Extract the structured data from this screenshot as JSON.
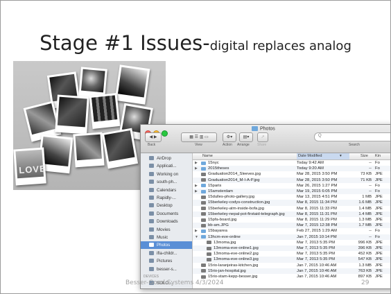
{
  "slide": {
    "title_main": "Stage #1 Issues-",
    "title_sub": "digital replaces analog",
    "footer": "Besser-Good Systems 4/3/2024",
    "page_number": "29"
  },
  "collage": {
    "text": "LOVE"
  },
  "finder": {
    "window_title": "Photos",
    "colors": {
      "selection": "#5a8fd6",
      "folder": "#6fa8dc",
      "sidebar_bg": "#e8ebef"
    },
    "toolbar": {
      "back_label": "Back",
      "view_label": "View",
      "action_label": "Action",
      "arrange_label": "Arrange",
      "share_label": "Share",
      "search_label": "Search",
      "search_glyph": "Q"
    },
    "sidebar": {
      "items": [
        {
          "label": "AirDrop",
          "icon": "airdrop-icon"
        },
        {
          "label": "Applicati...",
          "icon": "applications-icon"
        },
        {
          "label": "Working on",
          "icon": "folder-icon"
        },
        {
          "label": "south-ph...",
          "icon": "folder-icon"
        },
        {
          "label": "Calendars",
          "icon": "folder-icon"
        },
        {
          "label": "Rapidly-...",
          "icon": "folder-icon"
        },
        {
          "label": "Desktop",
          "icon": "desktop-icon"
        },
        {
          "label": "Documents",
          "icon": "documents-icon"
        },
        {
          "label": "Downloads",
          "icon": "downloads-icon"
        },
        {
          "label": "Movies",
          "icon": "movies-icon"
        },
        {
          "label": "Music",
          "icon": "music-icon"
        },
        {
          "label": "Photos",
          "icon": "photos-icon",
          "selected": true
        },
        {
          "label": "ifla-childr...",
          "icon": "folder-icon"
        },
        {
          "label": "Pictures",
          "icon": "pictures-icon"
        },
        {
          "label": "besser-s...",
          "icon": "folder-icon"
        }
      ],
      "devices_heading": "DEVICES",
      "device_item": "SOLO..."
    },
    "columns": {
      "name": "Name",
      "date": "Date Modified",
      "size": "Size",
      "kind": "Kin"
    },
    "rows": [
      {
        "name": "15nyc",
        "date": "Today 9:42 AM",
        "size": "--",
        "kind": "Fo",
        "type": "folder",
        "disc": "▶",
        "indent": 0
      },
      {
        "name": "2015theses",
        "date": "Today 9:20 AM",
        "size": "--",
        "kind": "Fo",
        "type": "folder",
        "disc": "▶",
        "indent": 0
      },
      {
        "name": "Graduation2014_Sleeves.jpg",
        "date": "Mar 28, 2015 3:50 PM",
        "size": "73 KB",
        "kind": "JPE",
        "type": "file",
        "disc": "",
        "indent": 0
      },
      {
        "name": "Graduation2014_M-I-A-P.jpg",
        "date": "Mar 28, 2015 3:50 PM",
        "size": "71 KB",
        "kind": "JPE",
        "type": "file",
        "disc": "",
        "indent": 0
      },
      {
        "name": "15paris",
        "date": "Mar 26, 2015 1:27 PM",
        "size": "--",
        "kind": "Fo",
        "type": "folder",
        "disc": "▶",
        "indent": 0
      },
      {
        "name": "15amsterdam",
        "date": "Mar 19, 2015 6:05 PM",
        "size": "--",
        "kind": "Fo",
        "type": "folder",
        "disc": "▶",
        "indent": 0
      },
      {
        "name": "15dulles-photo-gallery.jpg",
        "date": "Mar 13, 2015 4:51 PM",
        "size": "1 MB",
        "kind": "JPE",
        "type": "file",
        "disc": "",
        "indent": 0
      },
      {
        "name": "15berkeley-codys-construction.jpg",
        "date": "Mar 8, 2015 11:34 PM",
        "size": "1.6 MB",
        "kind": "JPE",
        "type": "file",
        "disc": "",
        "indent": 0
      },
      {
        "name": "15berkeley-atm-inside-bofa.jpg",
        "date": "Mar 8, 2015 11:33 PM",
        "size": "1.4 MB",
        "kind": "JPE",
        "type": "file",
        "disc": "",
        "indent": 0
      },
      {
        "name": "15berkeley-nepal-pot-firstaid-telegraph.jpg",
        "date": "Mar 8, 2015 11:31 PM",
        "size": "1.4 MB",
        "kind": "JPE",
        "type": "file",
        "disc": "",
        "indent": 0
      },
      {
        "name": "15pfa-board.jpg",
        "date": "Mar 8, 2015 11:29 PM",
        "size": "1.3 MB",
        "kind": "JPE",
        "type": "file",
        "disc": "",
        "indent": 0
      },
      {
        "name": "bb-am.JPG",
        "date": "Mar 7, 2015 12:38 PM",
        "size": "1.7 MB",
        "kind": "JPE",
        "type": "file",
        "disc": "",
        "indent": 0
      },
      {
        "name": "15bayarea",
        "date": "Feb 27, 2015 1:29 AM",
        "size": "--",
        "kind": "Fo",
        "type": "folder",
        "disc": "▶",
        "indent": 0
      },
      {
        "name": "13hcm-eve-online",
        "date": "Jan 7, 2015 10:14 PM",
        "size": "--",
        "kind": "Fo",
        "type": "folder",
        "disc": "▼",
        "indent": 0
      },
      {
        "name": "13moma.jpg",
        "date": "Mar 7, 2013 5:35 PM",
        "size": "996 KB",
        "kind": "JPE",
        "type": "file",
        "disc": "",
        "indent": 1
      },
      {
        "name": "13moma-eve-online1.jpg",
        "date": "Mar 7, 2013 5:35 PM",
        "size": "396 KB",
        "kind": "JPE",
        "type": "file",
        "disc": "",
        "indent": 1
      },
      {
        "name": "13moma-eve-online2.jpg",
        "date": "Mar 7, 2013 5:35 PM",
        "size": "452 KB",
        "kind": "JPE",
        "type": "file",
        "disc": "",
        "indent": 1
      },
      {
        "name": "13moma-eve-online3.jpg",
        "date": "Mar 7, 2013 5:35 PM",
        "size": "547 KB",
        "kind": "JPE",
        "type": "file",
        "disc": "",
        "indent": 1
      },
      {
        "name": "15rio-laranjeiras-kitchen.jpg",
        "date": "Jan 7, 2015 10:46 AM",
        "size": "1.3 MB",
        "kind": "JPE",
        "type": "file",
        "disc": "",
        "indent": 0
      },
      {
        "name": "15rio-jan-hospital.jpg",
        "date": "Jan 7, 2015 10:46 AM",
        "size": "763 KB",
        "kind": "JPE",
        "type": "file",
        "disc": "",
        "indent": 0
      },
      {
        "name": "15rio-stam-kepp-besser.jpg",
        "date": "Jan 7, 2015 10:46 AM",
        "size": "897 KB",
        "kind": "JPE",
        "type": "file",
        "disc": "",
        "indent": 0
      }
    ]
  }
}
